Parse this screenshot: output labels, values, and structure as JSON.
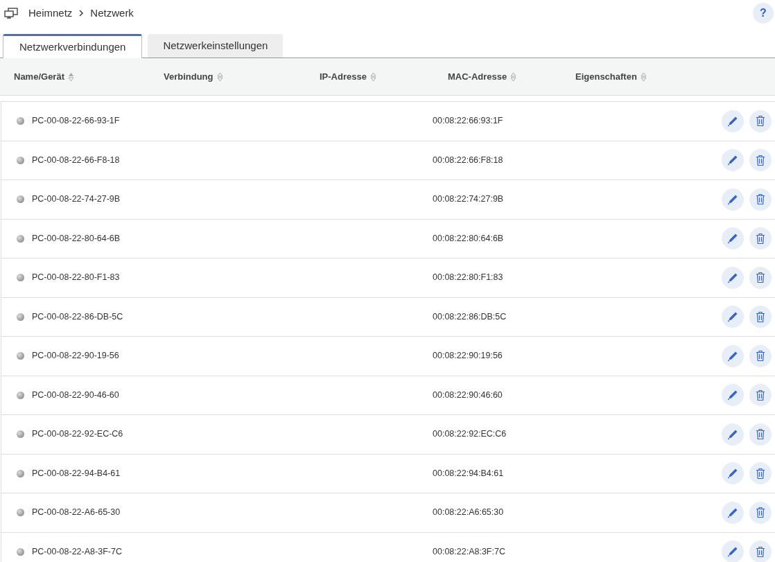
{
  "breadcrumb": [
    "Heimnetz",
    "Netzwerk"
  ],
  "help": "?",
  "tabs": [
    {
      "label": "Netzwerkverbindungen",
      "selected": true
    },
    {
      "label": "Netzwerkeinstellungen",
      "selected": false
    }
  ],
  "table": {
    "columns": [
      {
        "label": "Name/Gerät",
        "sorted": true
      },
      {
        "label": "Verbindung",
        "sorted": false
      },
      {
        "label": "IP-Adresse",
        "sorted": false
      },
      {
        "label": "MAC-Adresse",
        "sorted": false
      },
      {
        "label": "Eigenschaften",
        "sorted": false
      }
    ],
    "rows": [
      {
        "name": "PC-00-08-22-66-93-1F",
        "online": false,
        "mac": "00:08:22:66:93:1F"
      },
      {
        "name": "PC-00-08-22-66-F8-18",
        "online": false,
        "mac": "00:08:22:66:F8:18"
      },
      {
        "name": "PC-00-08-22-74-27-9B",
        "online": false,
        "mac": "00:08:22:74:27:9B"
      },
      {
        "name": "PC-00-08-22-80-64-6B",
        "online": false,
        "mac": "00:08:22:80:64:6B"
      },
      {
        "name": "PC-00-08-22-80-F1-83",
        "online": false,
        "mac": "00:08:22:80:F1:83"
      },
      {
        "name": "PC-00-08-22-86-DB-5C",
        "online": false,
        "mac": "00:08:22:86:DB:5C"
      },
      {
        "name": "PC-00-08-22-90-19-56",
        "online": false,
        "mac": "00:08:22:90:19:56"
      },
      {
        "name": "PC-00-08-22-90-46-60",
        "online": false,
        "mac": "00:08:22:90:46:60"
      },
      {
        "name": "PC-00-08-22-92-EC-C6",
        "online": false,
        "mac": "00:08:22:92:EC:C6"
      },
      {
        "name": "PC-00-08-22-94-B4-61",
        "online": false,
        "mac": "00:08:22:94:B4:61"
      },
      {
        "name": "PC-00-08-22-A6-65-30",
        "online": false,
        "mac": "00:08:22:A6:65:30"
      },
      {
        "name": "PC-00-08-22-A8-3F-7C",
        "online": false,
        "mac": "00:08:22:A8:3F:7C"
      }
    ]
  }
}
